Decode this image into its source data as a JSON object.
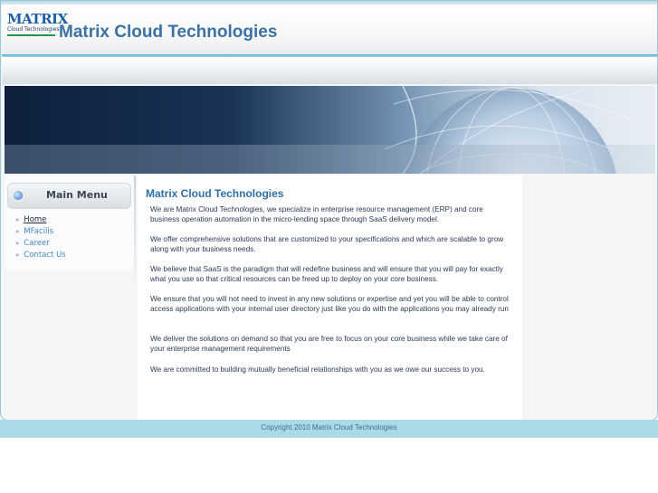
{
  "logo": {
    "line1": "MATRIX",
    "line2": "Cloud Technologies"
  },
  "header": {
    "title": "Matrix Cloud Technologies"
  },
  "sidebar": {
    "menu_title": "Main Menu",
    "items": [
      {
        "label": "Home",
        "current": true
      },
      {
        "label": "MFacilis",
        "current": false
      },
      {
        "label": "Career",
        "current": false
      },
      {
        "label": "Contact Us",
        "current": false
      }
    ]
  },
  "content": {
    "title": "Matrix Cloud Technologies",
    "paragraphs": [
      "We are Matrix Cloud Technologies, we specialize in enterprise resource management (ERP) and core business operation automation in the micro-lending space through SaaS delivery model.",
      "We offer comprehensive solutions that are customized to your specifications and which are scalable to grow along with your business needs.",
      "We believe that SaaS is the paradigm that will redefine business and will ensure that you will pay for exactly what you use so that critical resources can be freed up to deploy on your core business.",
      "We ensure that you will not need to invest in any new solutions or expertise and yet you will be able to control access applications with your internal user directory just like you do with the applications you may already run",
      "We deliver the solutions on demand so that you are free to focus on your core business while we take care of your enterprise management requirements",
      "We are committed to building mutually beneficial relationships with you as we owe our success to you."
    ]
  },
  "footer": {
    "copyright": "Copyright 2010 Matrix Cloud Technologies"
  },
  "colors": {
    "accent": "#3b72a3",
    "link": "#4a86bf",
    "footer_bg": "#a9dbe7"
  },
  "icons": {
    "menu_bullet": "globe-bullet-icon",
    "menu_item_marker": "double-chevron-right-icon"
  }
}
